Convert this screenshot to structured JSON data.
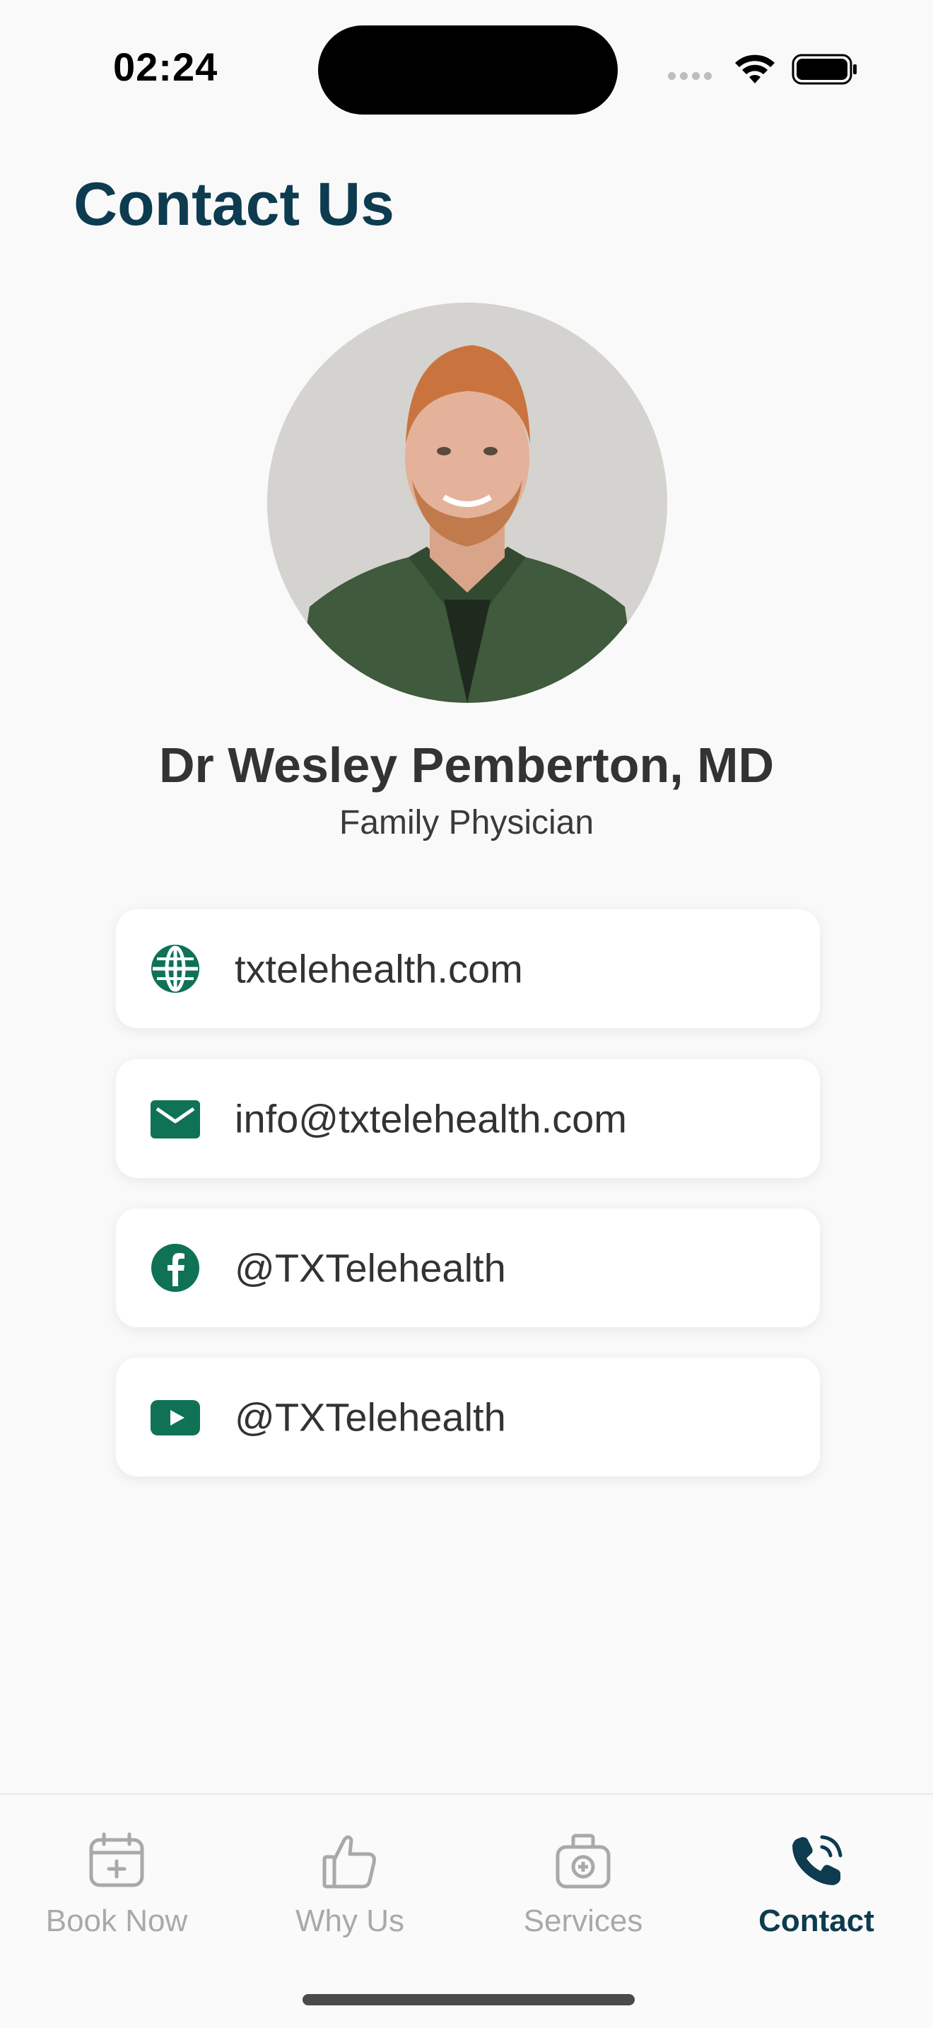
{
  "status_bar": {
    "time": "02:24"
  },
  "page": {
    "title": "Contact Us"
  },
  "profile": {
    "name": "Dr Wesley Pemberton, MD",
    "role": "Family Physician"
  },
  "contacts": [
    {
      "icon": "globe-icon",
      "label": "txtelehealth.com"
    },
    {
      "icon": "mail-icon",
      "label": "info@txtelehealth.com"
    },
    {
      "icon": "facebook-icon",
      "label": "@TXTelehealth"
    },
    {
      "icon": "youtube-icon",
      "label": "@TXTelehealth"
    }
  ],
  "tabs": [
    {
      "icon": "calendar-plus-icon",
      "label": "Book Now",
      "active": false
    },
    {
      "icon": "thumbs-up-icon",
      "label": "Why Us",
      "active": false
    },
    {
      "icon": "medical-bag-icon",
      "label": "Services",
      "active": false
    },
    {
      "icon": "phone-call-icon",
      "label": "Contact",
      "active": true
    }
  ],
  "colors": {
    "accent": "#0d3b4f",
    "icon_green": "#0f7255",
    "inactive": "#a9a9a9",
    "background": "#f9f9f9"
  }
}
